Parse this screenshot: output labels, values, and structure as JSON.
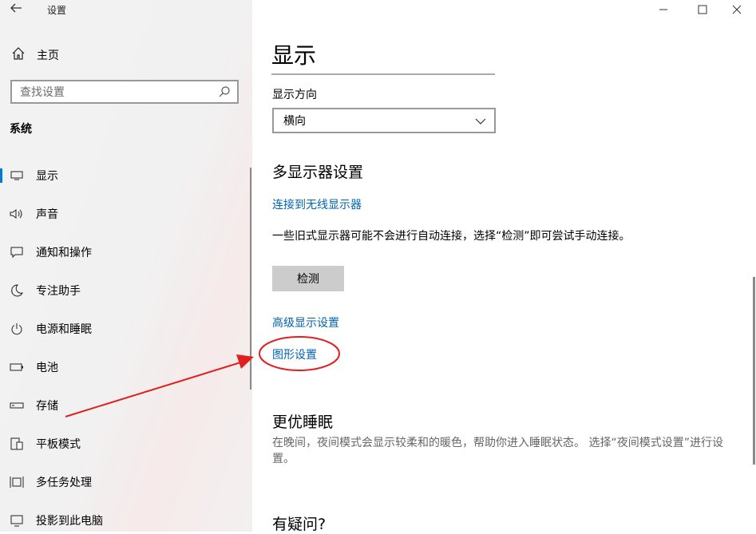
{
  "window": {
    "title": "设置",
    "back_icon": "back-arrow-icon",
    "minimize": "—",
    "maximize": "☐",
    "close": "✕"
  },
  "sidebar": {
    "home_label": "主页",
    "search_placeholder": "查找设置",
    "section_title": "系统",
    "items": [
      {
        "label": "显示",
        "icon": "display-icon",
        "selected": true
      },
      {
        "label": "声音",
        "icon": "speaker-icon",
        "selected": false
      },
      {
        "label": "通知和操作",
        "icon": "notification-icon",
        "selected": false
      },
      {
        "label": "专注助手",
        "icon": "moon-icon",
        "selected": false
      },
      {
        "label": "电源和睡眠",
        "icon": "power-icon",
        "selected": false
      },
      {
        "label": "电池",
        "icon": "battery-icon",
        "selected": false
      },
      {
        "label": "存储",
        "icon": "storage-icon",
        "selected": false
      },
      {
        "label": "平板模式",
        "icon": "tablet-mode-icon",
        "selected": false
      },
      {
        "label": "多任务处理",
        "icon": "multitasking-icon",
        "selected": false
      },
      {
        "label": "投影到此电脑",
        "icon": "project-icon",
        "selected": false
      }
    ]
  },
  "main": {
    "page_title": "显示",
    "orientation": {
      "label": "显示方向",
      "value": "横向"
    },
    "multi_display": {
      "heading": "多显示器设置",
      "wireless_link": "连接到无线显示器",
      "description": "一些旧式显示器可能不会进行自动连接，选择“检测”即可尝试手动连接。",
      "detect_button": "检测",
      "advanced_link": "高级显示设置",
      "graphics_link": "图形设置"
    },
    "sleep": {
      "heading": "更优睡眠",
      "description": "在晚间，夜间模式会显示较柔和的暖色，帮助你进入睡眠状态。 选择“夜间模式设置”进行设置。"
    },
    "questions": {
      "heading": "有疑问?"
    }
  },
  "annotation": {
    "color": "#e02020"
  },
  "colors": {
    "accent": "#0078d7",
    "link": "#0063b1"
  }
}
